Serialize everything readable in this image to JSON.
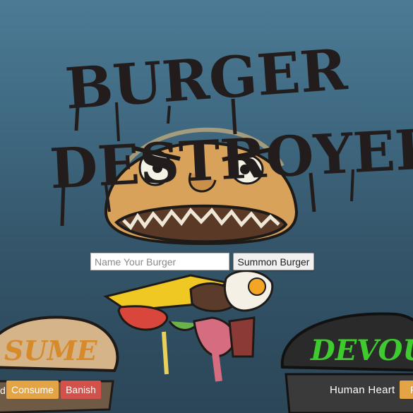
{
  "title": "BURGER DESTROYER",
  "title_words": [
    "BURGER",
    "DESTROYER"
  ],
  "summon": {
    "input_placeholder": "Name Your Burger",
    "button_label": "Summon Burger"
  },
  "left_card": {
    "stamp_text": "SUME",
    "partial_label": "d",
    "consume_label": "Consume",
    "banish_label": "Banish"
  },
  "right_card": {
    "stamp_text": "DEVOU",
    "ingredient_label": "Human Heart",
    "partial_button_label": "R"
  },
  "colors": {
    "background_top": "#4c7a95",
    "background_bottom": "#2b4657",
    "consume": "#e3a445",
    "banish": "#d3514b",
    "left_stamp": "#d68a2a",
    "right_stamp": "#3ecb2e"
  }
}
